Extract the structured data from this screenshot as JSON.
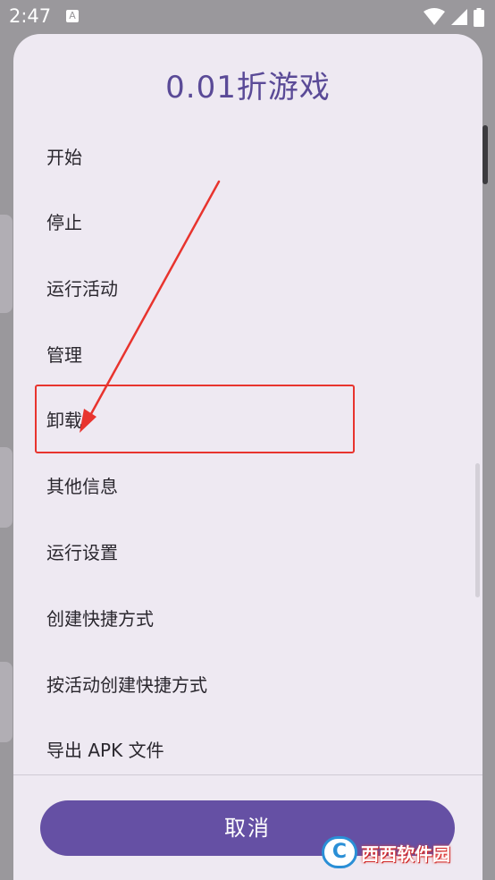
{
  "status_bar": {
    "time": "2:47",
    "notification_icon": "A"
  },
  "dialog": {
    "title": "0.01折游戏",
    "items": [
      {
        "label": "开始"
      },
      {
        "label": "停止"
      },
      {
        "label": "运行活动"
      },
      {
        "label": "管理"
      },
      {
        "label": "卸载"
      },
      {
        "label": "其他信息"
      },
      {
        "label": "运行设置"
      },
      {
        "label": "创建快捷方式"
      },
      {
        "label": "按活动创建快捷方式"
      },
      {
        "label": "导出 APK 文件"
      }
    ],
    "cancel_label": "取消",
    "highlighted_item": "卸载"
  },
  "annotation": {
    "color": "#e8342e"
  },
  "watermark": {
    "logo_text": "C",
    "text": "西西软件园"
  },
  "colors": {
    "accent": "#6550a4",
    "title": "#5a4a97",
    "dialog_bg": "#eee9f2",
    "scrim": "#9a989c"
  },
  "icons": [
    "wifi-icon",
    "signal-icon",
    "battery-icon"
  ]
}
